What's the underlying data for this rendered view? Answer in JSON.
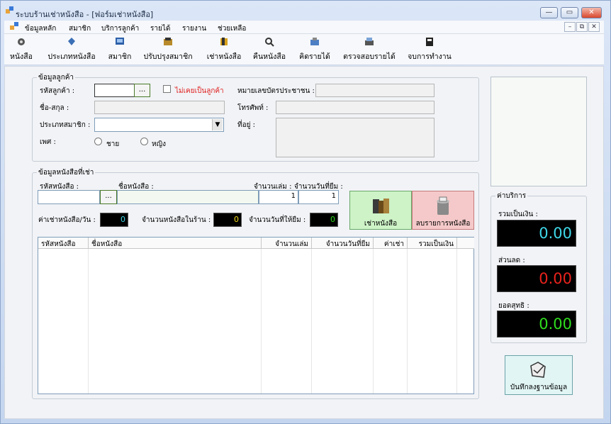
{
  "window": {
    "title": "ระบบร้านเช่าหนังสือ - [ฟอร์มเช่าหนังสือ]",
    "min": "—",
    "max": "▭",
    "close": "✕"
  },
  "menu": {
    "items": [
      "ข้อมูลหลัก",
      "สมาชิก",
      "บริการลูกค้า",
      "รายได้",
      "รายงาน",
      "ช่วยเหลือ"
    ],
    "mdi": [
      "–",
      "⧉",
      "✕"
    ]
  },
  "toolbar": {
    "items": [
      {
        "label": "หนังสือ",
        "icon": "book-icon"
      },
      {
        "label": "ประเภทหนังสือ",
        "icon": "category-icon"
      },
      {
        "label": "สมาชิก",
        "icon": "member-icon"
      },
      {
        "label": "ปรับปรุงสมาชิก",
        "icon": "edit-member-icon"
      },
      {
        "label": "เช่าหนังสือ",
        "icon": "rent-icon"
      },
      {
        "label": "คืนหนังสือ",
        "icon": "return-icon"
      },
      {
        "label": "คิดรายได้",
        "icon": "income-icon"
      },
      {
        "label": "ตรวจสอบรายได้",
        "icon": "check-income-icon"
      },
      {
        "label": "จบการทำงาน",
        "icon": "exit-icon"
      }
    ]
  },
  "customer": {
    "legend": "ข้อมูลลูกค้า",
    "id_label": "รหัสลูกค้า :",
    "id_value": "",
    "browse": "...",
    "not_customer_label": "ไม่เคยเป็นลูกค้า",
    "citizen_id_label": "หมายเลขบัตรประชาชน :",
    "name_label": "ชื่อ-สกุล :",
    "phone_label": "โทรศัพท์ :",
    "member_type_label": "ประเภทสมาชิก :",
    "address_label": "ที่อยู่ :",
    "gender_label": "เพศ :",
    "male": "ชาย",
    "female": "หญิง"
  },
  "book": {
    "legend": "ข้อมูลหนังสือที่เช่า",
    "code_label": "รหัสหนังสือ :",
    "browse": "...",
    "name_label": "ชื่อหนังสือ :",
    "qty_label": "จำนวนเล่ม :",
    "days_label": "จำนวนวันที่ยืม :",
    "qty_value": "1",
    "days_value": "1",
    "rent_per_day_label": "ค่าเช่าหนังสือ/วัน :",
    "rent_per_day_value": "0",
    "stock_label": "จำนวนหนังสือในร้าน :",
    "stock_value": "0",
    "allowed_days_label": "จำนวนวันที่ให้ยืม :",
    "allowed_days_value": "0",
    "rent_button": "เช่าหนังสือ",
    "delete_button": "ลบรายการหนังสือ"
  },
  "grid": {
    "columns": [
      "รหัสหนังสือ",
      "ชื่อหนังสือ",
      "จำนวนเล่ม",
      "จำนวนวันที่ยืม",
      "ค่าเช่า",
      "รวมเป็นเงิน"
    ]
  },
  "fees": {
    "legend": "ค่าบริการ",
    "total_label": "รวมเป็นเงิน :",
    "total_value": "0.00",
    "discount_label": "ส่วนลด :",
    "discount_value": "0.00",
    "net_label": "ยอดสุทธิ :",
    "net_value": "0.00",
    "colors": {
      "total": "#3fd8e8",
      "discount": "#e8221c",
      "net": "#2fdc1e"
    }
  },
  "save_button": "บันทึกลงฐานข้อมูล"
}
